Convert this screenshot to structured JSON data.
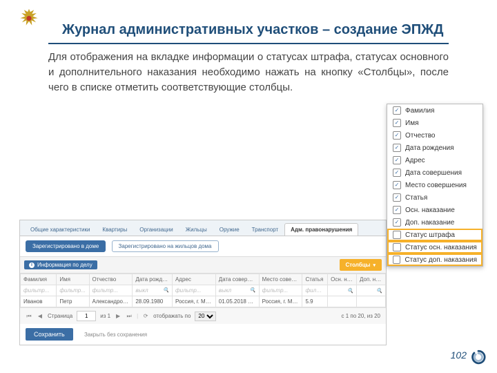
{
  "title": "Журнал административных участков – создание ЭПЖД",
  "paragraph": "Для отображения на вкладке информации о статусах штрафа, статусах основного и дополнительного наказания необходимо нажать на кнопку «Столбцы», после чего в списке отметить соответствующие столбцы.",
  "page_number": "102",
  "tabs": [
    "Общие характеристики",
    "Квартиры",
    "Организации",
    "Жильцы",
    "Оружие",
    "Транспорт",
    "Адм. правонарушения"
  ],
  "tabs_active": 6,
  "subtabs": {
    "active": "Зарегистрировано в доме",
    "other": "Зарегистрировано на жильцов дома"
  },
  "info_btn": "Информация по делу",
  "columns_btn": "Столбцы",
  "headers": [
    "Фамилия",
    "Имя",
    "Отчество",
    "Дата рождения",
    "Адрес",
    "Дата соверше...",
    "Место соверш...",
    "Статья",
    "Осн. наказание",
    "Доп. наказание"
  ],
  "filter_label": "фильтр...",
  "filter_date": "выкл",
  "row": {
    "fam": "Иванов",
    "name": "Петр",
    "otch": "Александрович",
    "dob": "28.09.1980",
    "addr": "Россия, г. Мос...",
    "date": "01.05.2018 12:...",
    "place": "Россия, г. Мос...",
    "art": "5.9",
    "osn": "",
    "dop": ""
  },
  "pager": {
    "page": "1",
    "of_label": "из 1",
    "show_label": "отображать по",
    "per_page": "20",
    "range": "с 1 по 20, из 20",
    "page_label": "Страница"
  },
  "buttons": {
    "save": "Сохранить",
    "close": "Закрыть без сохранения"
  },
  "popup": [
    {
      "label": "Фамилия",
      "on": true
    },
    {
      "label": "Имя",
      "on": true
    },
    {
      "label": "Отчество",
      "on": true
    },
    {
      "label": "Дата рождения",
      "on": true
    },
    {
      "label": "Адрес",
      "on": true
    },
    {
      "label": "Дата совершения",
      "on": true
    },
    {
      "label": "Место совершения",
      "on": true
    },
    {
      "label": "Статья",
      "on": true
    },
    {
      "label": "Осн. наказание",
      "on": true
    },
    {
      "label": "Доп. наказание",
      "on": true
    },
    {
      "label": "Статус штрафа",
      "on": false,
      "hl": true
    },
    {
      "label": "Статус осн. наказания",
      "on": false,
      "hl": true
    },
    {
      "label": "Статус доп. наказания",
      "on": false,
      "hl": true
    }
  ]
}
